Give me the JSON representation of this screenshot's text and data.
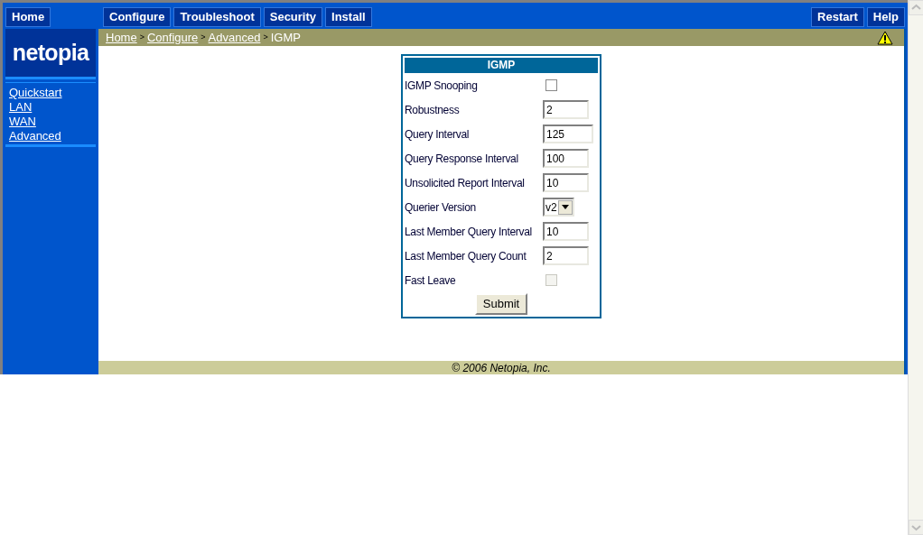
{
  "top_nav": {
    "left": [
      {
        "label": "Home"
      }
    ],
    "middle": [
      {
        "label": "Configure"
      },
      {
        "label": "Troubleshoot"
      },
      {
        "label": "Security"
      },
      {
        "label": "Install"
      }
    ],
    "right": [
      {
        "label": "Restart"
      },
      {
        "label": "Help"
      }
    ]
  },
  "sidebar": {
    "logo": "netopia",
    "links": [
      "Quickstart",
      "LAN",
      "WAN",
      "Advanced"
    ]
  },
  "breadcrumb": {
    "links": [
      "Home",
      "Configure",
      "Advanced"
    ],
    "current": "IGMP",
    "separator": ">"
  },
  "form": {
    "title": "IGMP",
    "fields": [
      {
        "kind": "checkbox",
        "label": "IGMP Snooping",
        "checked": false,
        "disabled": false
      },
      {
        "kind": "text",
        "label": "Robustness",
        "value": "2",
        "wide": false
      },
      {
        "kind": "text",
        "label": "Query Interval",
        "value": "125",
        "wide": true
      },
      {
        "kind": "text",
        "label": "Query Response Interval",
        "value": "100",
        "wide": false
      },
      {
        "kind": "text",
        "label": "Unsolicited Report Interval",
        "value": "10",
        "wide": false
      },
      {
        "kind": "select",
        "label": "Querier Version",
        "value": "v2"
      },
      {
        "kind": "text",
        "label": "Last Member Query Interval",
        "value": "10",
        "wide": false
      },
      {
        "kind": "text",
        "label": "Last Member Query Count",
        "value": "2",
        "wide": false
      },
      {
        "kind": "checkbox",
        "label": "Fast Leave",
        "checked": false,
        "disabled": true
      }
    ],
    "submit": "Submit"
  },
  "footer": "© 2006 Netopia, Inc."
}
